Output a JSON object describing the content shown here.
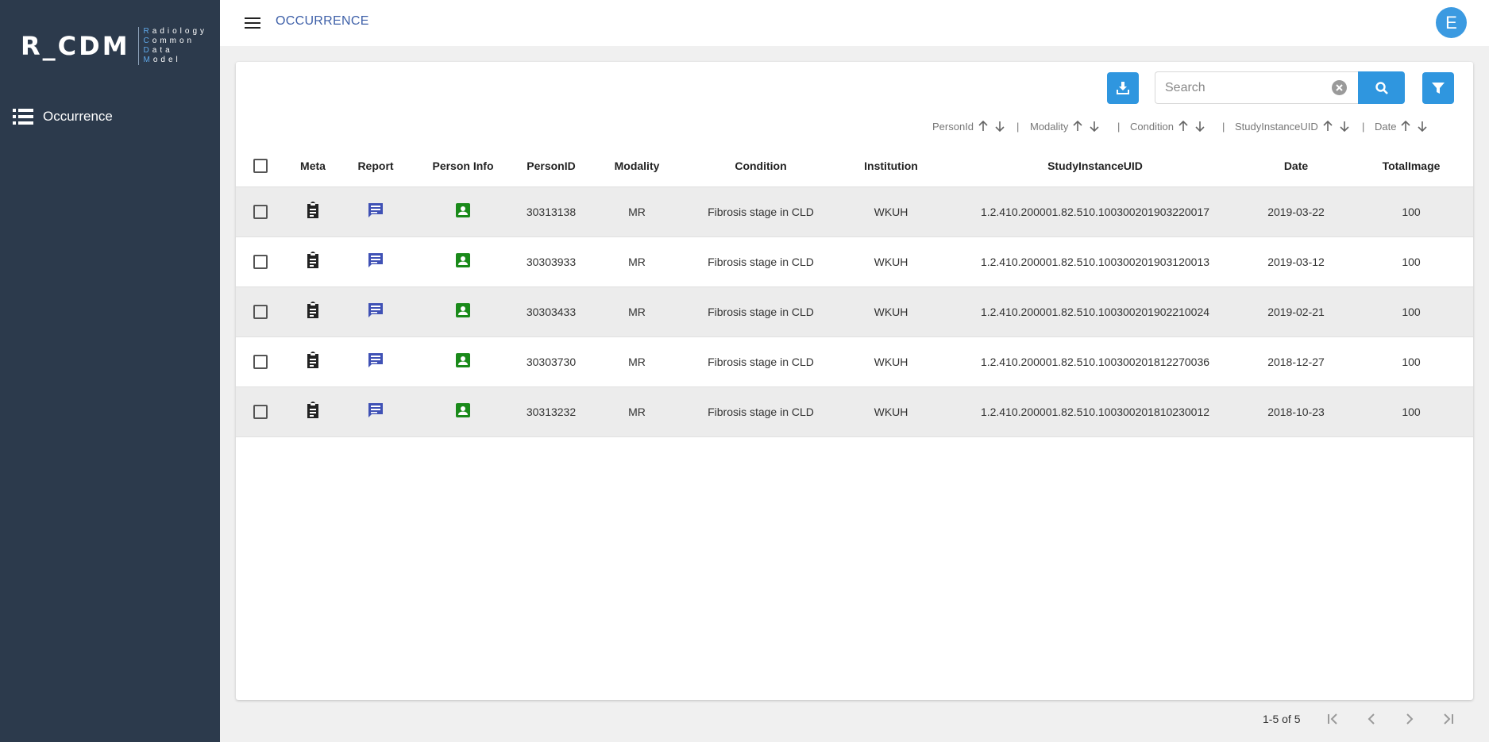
{
  "sidebar": {
    "logo_main": "R_CDM",
    "logo_sub": [
      "Radiology",
      "Common",
      "Data",
      "Model"
    ],
    "nav_items": [
      {
        "label": "Occurrence",
        "icon": "list-icon"
      }
    ]
  },
  "topbar": {
    "title": "OCCURRENCE",
    "avatar_letter": "E"
  },
  "toolbar": {
    "search_placeholder": "Search",
    "search_value": ""
  },
  "sort_options": [
    {
      "label": "PersonId"
    },
    {
      "label": "Modality"
    },
    {
      "label": "Condition"
    },
    {
      "label": "StudyInstanceUID"
    },
    {
      "label": "Date"
    }
  ],
  "sort_separator": "|",
  "table": {
    "headers": [
      "Meta",
      "Report",
      "Person Info",
      "PersonID",
      "Modality",
      "Condition",
      "Institution",
      "StudyInstanceUID",
      "Date",
      "TotalImage"
    ],
    "rows": [
      {
        "person_id": "30313138",
        "modality": "MR",
        "condition": "Fibrosis stage in CLD",
        "institution": "WKUH",
        "study_uid": "1.2.410.200001.82.510.100300201903220017",
        "date": "2019-03-22",
        "total_image": "100"
      },
      {
        "person_id": "30303933",
        "modality": "MR",
        "condition": "Fibrosis stage in CLD",
        "institution": "WKUH",
        "study_uid": "1.2.410.200001.82.510.100300201903120013",
        "date": "2019-03-12",
        "total_image": "100"
      },
      {
        "person_id": "30303433",
        "modality": "MR",
        "condition": "Fibrosis stage in CLD",
        "institution": "WKUH",
        "study_uid": "1.2.410.200001.82.510.100300201902210024",
        "date": "2019-02-21",
        "total_image": "100"
      },
      {
        "person_id": "30303730",
        "modality": "MR",
        "condition": "Fibrosis stage in CLD",
        "institution": "WKUH",
        "study_uid": "1.2.410.200001.82.510.100300201812270036",
        "date": "2018-12-27",
        "total_image": "100"
      },
      {
        "person_id": "30313232",
        "modality": "MR",
        "condition": "Fibrosis stage in CLD",
        "institution": "WKUH",
        "study_uid": "1.2.410.200001.82.510.100300201810230012",
        "date": "2018-10-23",
        "total_image": "100"
      }
    ]
  },
  "pagination": {
    "info": "1-5 of 5"
  },
  "colors": {
    "sidebar_bg": "#2c3a4c",
    "accent": "#2f96df",
    "title": "#3d5fa8",
    "report_icon": "#3f51b5",
    "person_icon": "#1a8a1a",
    "meta_icon": "#222222"
  },
  "icons": {
    "meta": "clipboard-icon",
    "report": "comment-icon",
    "person": "account-box-icon",
    "download": "download-icon",
    "search": "search-icon",
    "filter": "filter-icon",
    "clear": "clear-icon"
  }
}
